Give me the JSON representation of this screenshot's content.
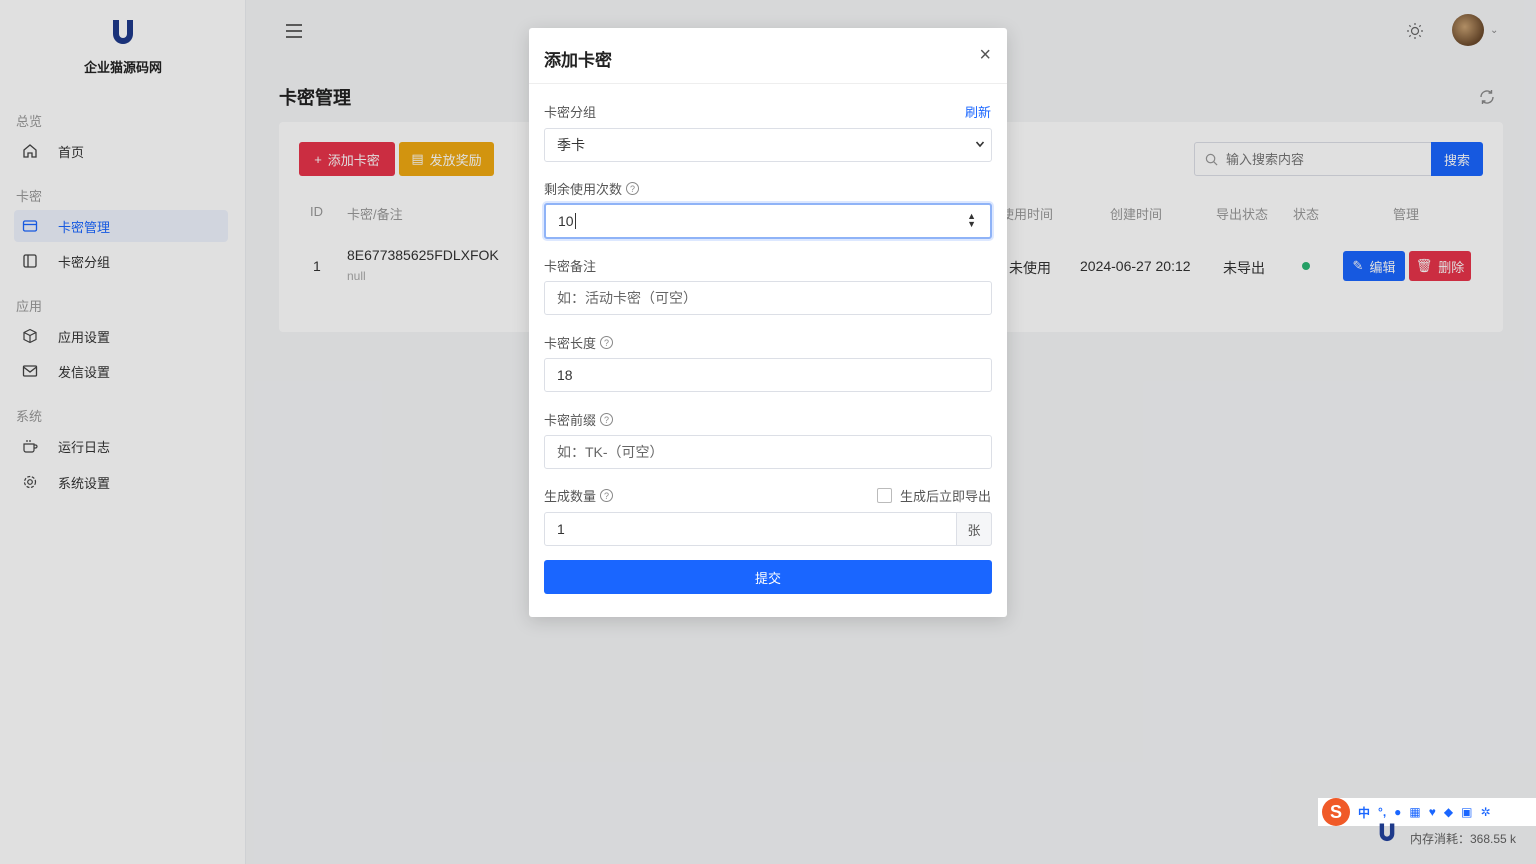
{
  "sidebar": {
    "logo_text": "企业猫源码网",
    "groups": {
      "overview": "总览",
      "card": "卡密",
      "app": "应用",
      "system": "系统"
    },
    "items": {
      "home": "首页",
      "card_manage": "卡密管理",
      "card_group": "卡密分组",
      "app_settings": "应用设置",
      "mail_settings": "发信设置",
      "run_log": "运行日志",
      "system_settings": "系统设置"
    }
  },
  "page": {
    "title": "卡密管理",
    "add_button": "添加卡密",
    "reward_button": "发放奖励",
    "search_placeholder": "输入搜索内容",
    "search_button": "搜索"
  },
  "table": {
    "headers": {
      "id": "ID",
      "card": "卡密/备注",
      "use_time": "使用时间",
      "create_time": "创建时间",
      "export_status": "导出状态",
      "status": "状态",
      "manage": "管理"
    },
    "row": {
      "id": "1",
      "card": "8E677385625FDLXFOK",
      "note": "null",
      "use_time": "未使用",
      "create_time": "2024-06-27 20:12",
      "export_status": "未导出",
      "edit": "编辑",
      "delete": "删除"
    }
  },
  "modal": {
    "title": "添加卡密",
    "close": "×",
    "group_label": "卡密分组",
    "refresh_link": "刷新",
    "group_value": "季卡",
    "uses_label": "剩余使用次数",
    "uses_value": "10",
    "note_label": "卡密备注",
    "note_placeholder": "如：活动卡密（可空）",
    "length_label": "卡密长度",
    "length_value": "18",
    "prefix_label": "卡密前缀",
    "prefix_placeholder": "如：TK-（可空）",
    "count_label": "生成数量",
    "export_checkbox": "生成后立即导出",
    "count_value": "1",
    "count_suffix": "张",
    "submit": "提交"
  },
  "footer": {
    "ime_items": [
      "中",
      "°,"
    ],
    "memory": "内存消耗：368.55 k"
  },
  "colors": {
    "primary": "#1a66ff",
    "danger": "#e8344a",
    "warning": "#f0a912",
    "success": "#2bb673"
  }
}
